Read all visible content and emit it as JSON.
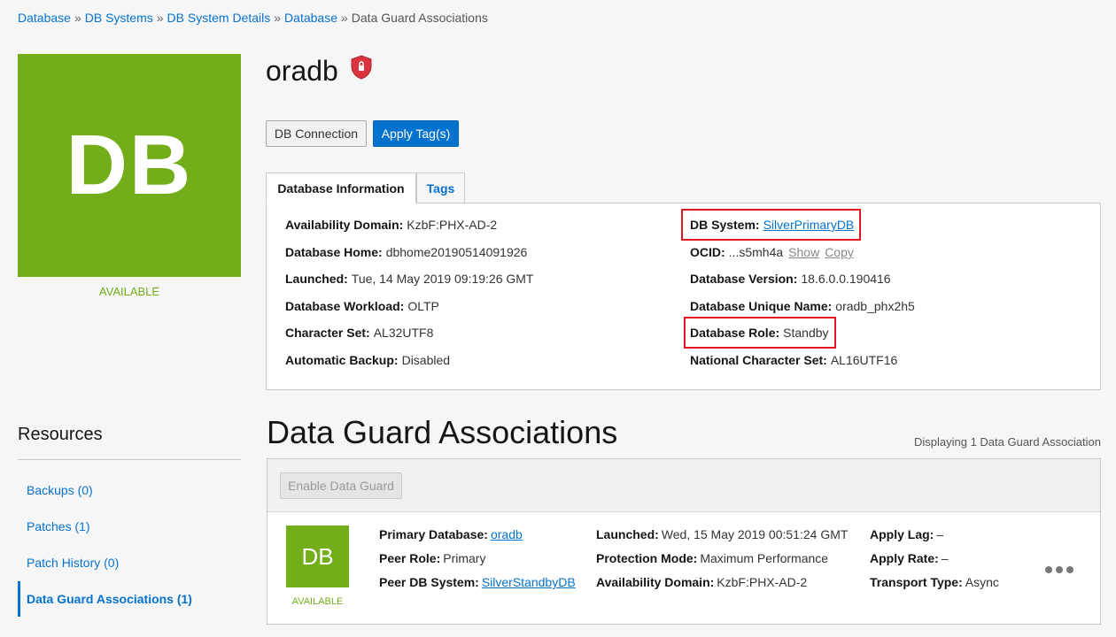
{
  "breadcrumb": {
    "items": [
      "Database",
      "DB Systems",
      "DB System Details",
      "Database"
    ],
    "current": "Data Guard Associations",
    "separator": "»"
  },
  "database": {
    "tile_text": "DB",
    "status": "AVAILABLE",
    "name": "oradb",
    "status_color": "#74ad1a"
  },
  "actions": {
    "db_connection": "DB Connection",
    "apply_tags": "Apply Tag(s)"
  },
  "tabs": {
    "database_information": "Database Information",
    "tags": "Tags"
  },
  "info": {
    "left": [
      {
        "label": "Availability Domain:",
        "value": "KzbF:PHX-AD-2"
      },
      {
        "label": "Database Home:",
        "value": "dbhome20190514091926"
      },
      {
        "label": "Launched:",
        "value": "Tue, 14 May 2019 09:19:26 GMT"
      },
      {
        "label": "Database Workload:",
        "value": "OLTP"
      },
      {
        "label": "Character Set:",
        "value": "AL32UTF8"
      },
      {
        "label": "Automatic Backup:",
        "value": "Disabled"
      }
    ],
    "db_system": {
      "label": "DB System:",
      "value": "SilverPrimaryDB"
    },
    "ocid": {
      "label": "OCID:",
      "value": "...s5mh4a",
      "show": "Show",
      "copy": "Copy"
    },
    "db_version": {
      "label": "Database Version:",
      "value": "18.6.0.0.190416"
    },
    "unique_name": {
      "label": "Database Unique Name:",
      "value": "oradb_phx2h5"
    },
    "role": {
      "label": "Database Role:",
      "value": "Standby"
    },
    "ncharset": {
      "label": "National Character Set:",
      "value": "AL16UTF16"
    }
  },
  "resources": {
    "title": "Resources",
    "items": [
      "Backups (0)",
      "Patches (1)",
      "Patch History (0)",
      "Data Guard Associations (1)"
    ]
  },
  "data_guard": {
    "title": "Data Guard Associations",
    "displaying": "Displaying 1 Data Guard Association",
    "enable_button": "Enable Data Guard",
    "row": {
      "tile_text": "DB",
      "status": "AVAILABLE",
      "primary_db_label": "Primary Database:",
      "primary_db_value": "oradb",
      "peer_role_label": "Peer Role:",
      "peer_role_value": "Primary",
      "peer_db_label": "Peer DB System:",
      "peer_db_value": "SilverStandbyDB",
      "launched_label": "Launched:",
      "launched_value": "Wed, 15 May 2019 00:51:24 GMT",
      "protection_label": "Protection Mode:",
      "protection_value": "Maximum Performance",
      "ad_label": "Availability Domain:",
      "ad_value": "KzbF:PHX-AD-2",
      "apply_lag_label": "Apply Lag:",
      "apply_lag_value": "–",
      "apply_rate_label": "Apply Rate:",
      "apply_rate_value": "–",
      "transport_label": "Transport Type:",
      "transport_value": "Async"
    }
  },
  "colors": {
    "accent": "#0572ce",
    "available": "#74ad1a",
    "highlight": "#e0161e"
  }
}
